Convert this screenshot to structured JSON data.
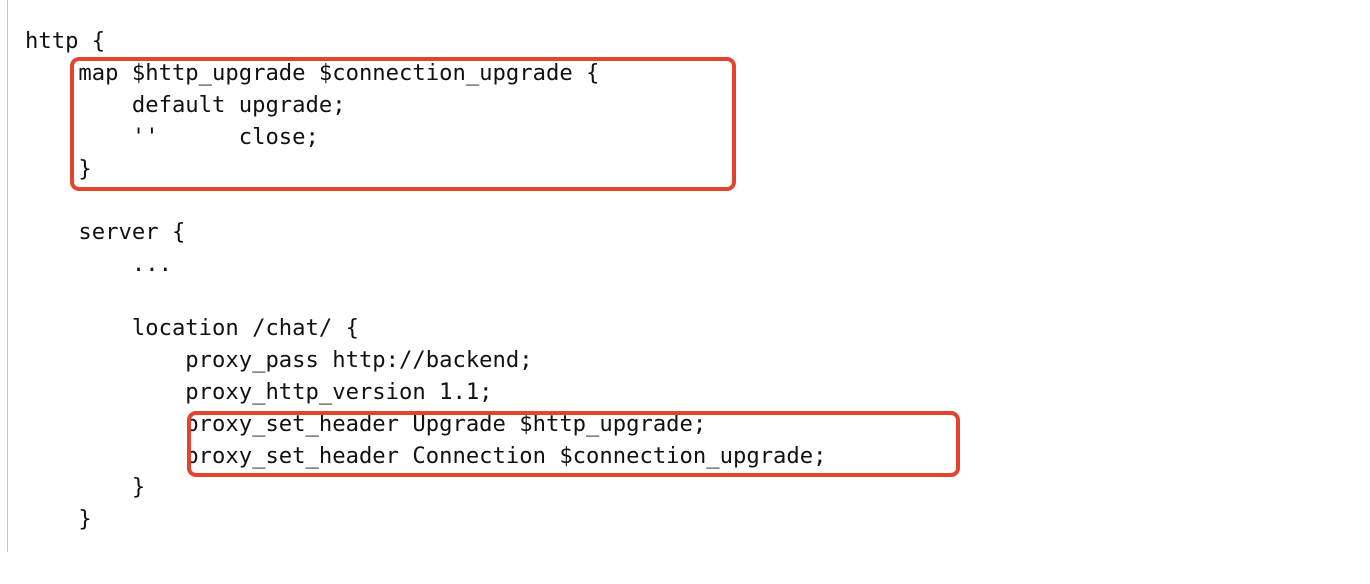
{
  "code": {
    "lines": [
      "http {",
      "    map $http_upgrade $connection_upgrade {",
      "        default upgrade;",
      "        ''      close;",
      "    }",
      "",
      "    server {",
      "        ...",
      "",
      "        location /chat/ {",
      "            proxy_pass http://backend;",
      "            proxy_http_version 1.1;",
      "            proxy_set_header Upgrade $http_upgrade;",
      "            proxy_set_header Connection $connection_upgrade;",
      "        }",
      "    }"
    ]
  },
  "colors": {
    "text": "#111111",
    "highlight_border": "#e1452d",
    "background": "#ffffff",
    "left_rule": "#c8c8c8"
  }
}
